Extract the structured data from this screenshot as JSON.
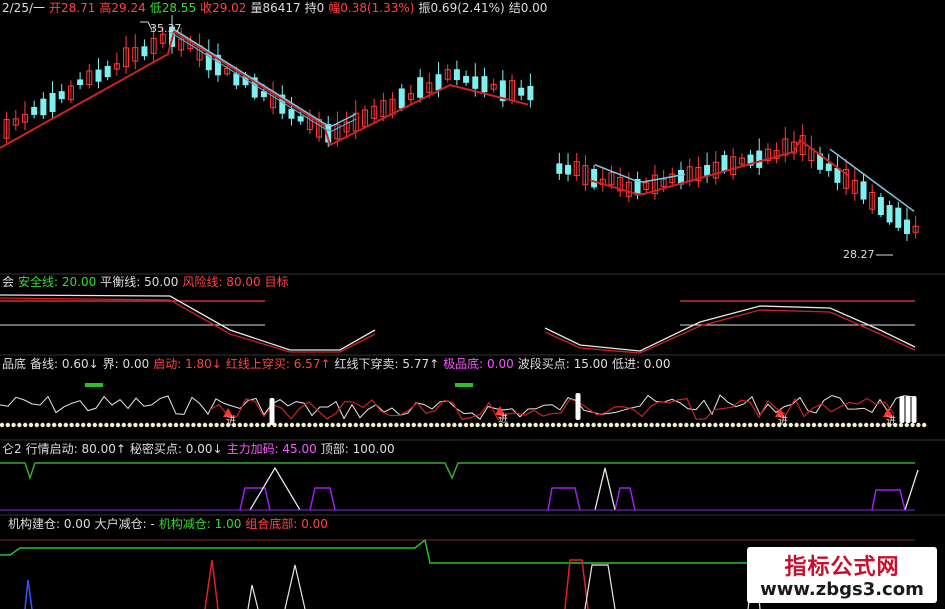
{
  "colors": {
    "bg": "#000000",
    "up": "#ff3b3b",
    "down": "#7ff0f0",
    "ma_red": "#cc2222",
    "ma_blue": "#7ec8e3",
    "white": "#e8e8e8",
    "green": "#33cc33",
    "purple": "#a020f0",
    "yellow": "#ffd84a",
    "magenta": "#ff55ff"
  },
  "main": {
    "header": [
      {
        "t": "2/25/一",
        "c": "#dddddd"
      },
      {
        "t": "开28.71",
        "c": "#ff4444"
      },
      {
        "t": "高29.24",
        "c": "#ff4444"
      },
      {
        "t": "低28.55",
        "c": "#33dd33"
      },
      {
        "t": "收29.02",
        "c": "#ff4444"
      },
      {
        "t": "量86417",
        "c": "#dddddd"
      },
      {
        "t": "持0",
        "c": "#dddddd"
      },
      {
        "t": "幅0.38(1.33%)",
        "c": "#ff4444"
      },
      {
        "t": "振0.69(2.41%)",
        "c": "#dddddd"
      },
      {
        "t": "结0.00",
        "c": "#dddddd"
      }
    ],
    "high_label": "35.37",
    "low_label": "28.27"
  },
  "panel1": {
    "items": [
      {
        "t": "会",
        "c": "#dddddd"
      },
      {
        "t": "安全线: 20.00",
        "c": "#33dd33"
      },
      {
        "t": "平衡线: 50.00",
        "c": "#dddddd"
      },
      {
        "t": "风险线: 80.00",
        "c": "#ff4444"
      },
      {
        "t": "目标",
        "c": "#ff4444"
      }
    ]
  },
  "panel2": {
    "items": [
      {
        "t": "品底",
        "c": "#dddddd"
      },
      {
        "t": "备线: 0.60↓",
        "c": "#dddddd"
      },
      {
        "t": "界: 0.00",
        "c": "#dddddd"
      },
      {
        "t": "启动: 1.80↓",
        "c": "#ff4444"
      },
      {
        "t": "红线上穿买: 6.57↑",
        "c": "#ff4444"
      },
      {
        "t": "红线下穿卖: 5.77↑",
        "c": "#dddddd"
      },
      {
        "t": "极品底: 0.00",
        "c": "#ff55ff"
      },
      {
        "t": "波段买点: 15.00",
        "c": "#dddddd"
      },
      {
        "t": "低进: 0.00",
        "c": "#dddddd"
      }
    ],
    "marker": "进"
  },
  "panel3": {
    "items": [
      {
        "t": "仑2",
        "c": "#dddddd"
      },
      {
        "t": "行情启动: 80.00↑",
        "c": "#dddddd"
      },
      {
        "t": "秘密买点: 0.00↓",
        "c": "#dddddd"
      },
      {
        "t": "主力加码: 45.00",
        "c": "#ff55ff"
      },
      {
        "t": "顶部: 100.00",
        "c": "#dddddd"
      }
    ]
  },
  "panel4": {
    "items": [
      {
        "t": "机构建仓: 0.00",
        "c": "#dddddd"
      },
      {
        "t": "大户减仓: -",
        "c": "#dddddd"
      },
      {
        "t": "机构减仓: 1.00",
        "c": "#33dd33"
      },
      {
        "t": "组合底部: 0.00",
        "c": "#ff4444"
      }
    ]
  },
  "watermark": {
    "line1": "指标公式网",
    "line2": "www.zbgs3.com"
  }
}
